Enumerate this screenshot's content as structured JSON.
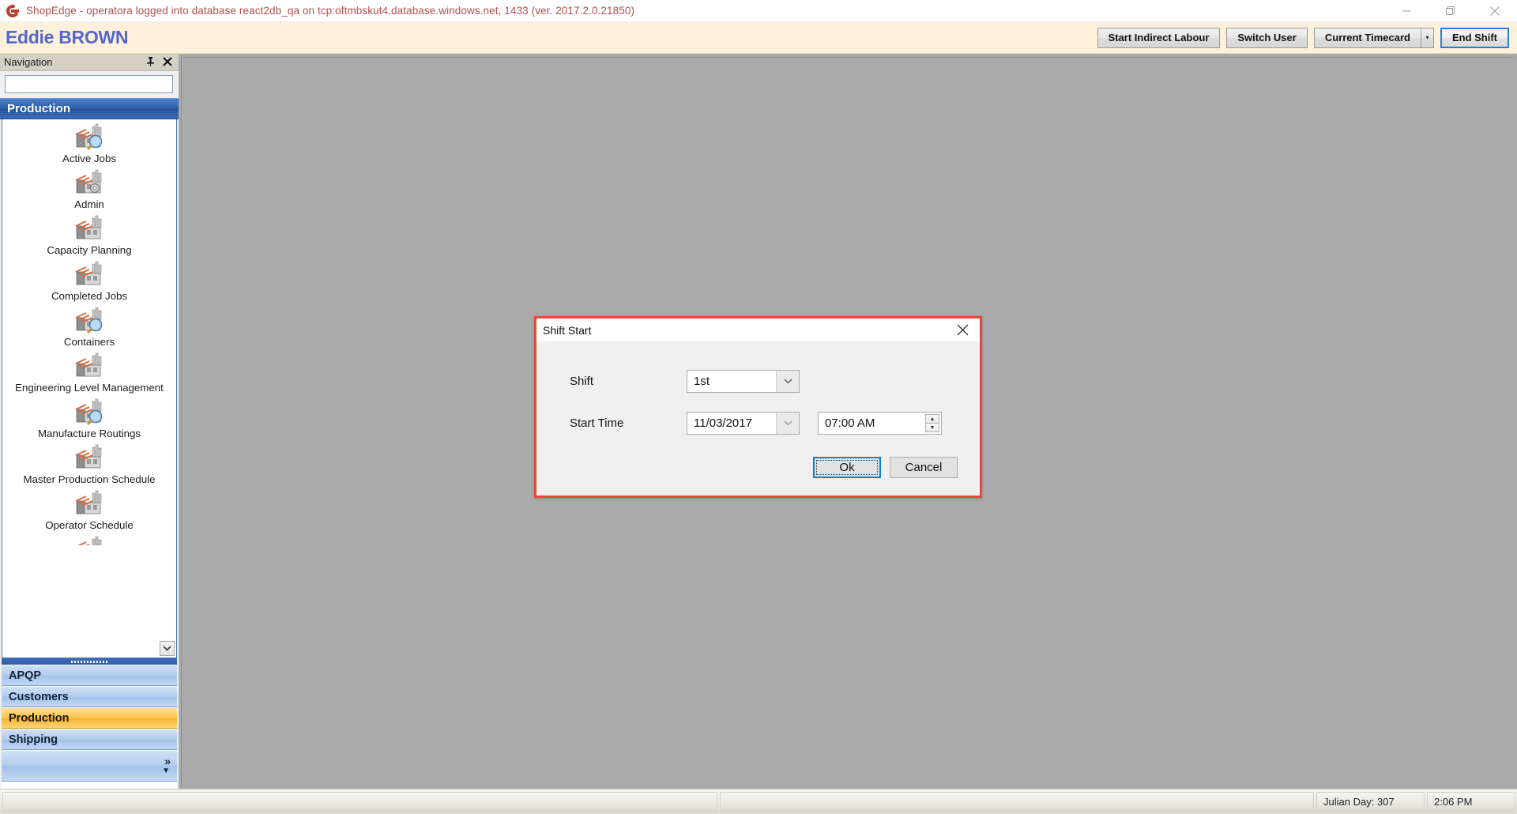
{
  "window": {
    "title": "ShopEdge - operatora logged into database react2db_qa on tcp:oftmbskut4.database.windows.net, 1433 (ver. 2017.2.0.21850)",
    "app_icon": "shopedge-logo-icon",
    "minimize": "minimize-icon",
    "restore": "restore-icon",
    "close": "close-icon"
  },
  "header": {
    "username": "Eddie BROWN",
    "buttons": [
      {
        "label": "Start Indirect Labour",
        "name": "start-indirect-labour-button"
      },
      {
        "label": "Switch User",
        "name": "switch-user-button"
      },
      {
        "label": "Current Timecard",
        "name": "current-timecard-button"
      },
      {
        "label": "End Shift",
        "name": "end-shift-button"
      }
    ],
    "split_arrow": "▾",
    "accent_primary": "#2a7fd4",
    "bar_bg": "#fdf1dc"
  },
  "navigation": {
    "panel_title": "Navigation",
    "pin_icon": "pin-icon",
    "close_icon": "close-icon",
    "search_value": "",
    "search_placeholder": "",
    "group_title": "Production",
    "items": [
      {
        "label": "Active Jobs",
        "icon": "factory-search-icon"
      },
      {
        "label": "Admin",
        "icon": "factory-gear-icon"
      },
      {
        "label": "Capacity Planning",
        "icon": "factory-icon"
      },
      {
        "label": "Completed Jobs",
        "icon": "factory-icon"
      },
      {
        "label": "Containers",
        "icon": "factory-search-icon"
      },
      {
        "label": "Engineering Level Management",
        "icon": "factory-icon"
      },
      {
        "label": "Manufacture Routings",
        "icon": "factory-search-icon"
      },
      {
        "label": "Master Production Schedule",
        "icon": "factory-icon"
      },
      {
        "label": "Operator Schedule",
        "icon": "factory-icon"
      }
    ],
    "scroll_down_icon": "chevron-down-icon",
    "groups": [
      {
        "label": "APQP",
        "active": false
      },
      {
        "label": "Customers",
        "active": false
      },
      {
        "label": "Production",
        "active": true
      },
      {
        "label": "Shipping",
        "active": false
      }
    ],
    "overflow_icon": "chevrons-right-icon",
    "overflow_down_icon": "caret-down-icon",
    "active_group_color": "#f6b32a"
  },
  "dialog": {
    "title": "Shift Start",
    "close_icon": "close-icon",
    "border_color": "#e8483c",
    "fields": [
      {
        "label": "Shift",
        "name": "shift",
        "value": "1st"
      },
      {
        "label": "Start Time",
        "name": "start-time",
        "date": "11/03/2017",
        "time": "07:00 AM"
      }
    ],
    "dropdown_icon": "chevron-down-icon",
    "spin_up_icon": "caret-up-icon",
    "spin_down_icon": "caret-down-icon",
    "ok_label": "Ok",
    "cancel_label": "Cancel"
  },
  "statusbar": {
    "left_text": "",
    "mid_text": "",
    "julian_day": "Julian Day: 307",
    "clock": "2:06 PM"
  },
  "workspace": {
    "background": "#aaaaaa"
  }
}
